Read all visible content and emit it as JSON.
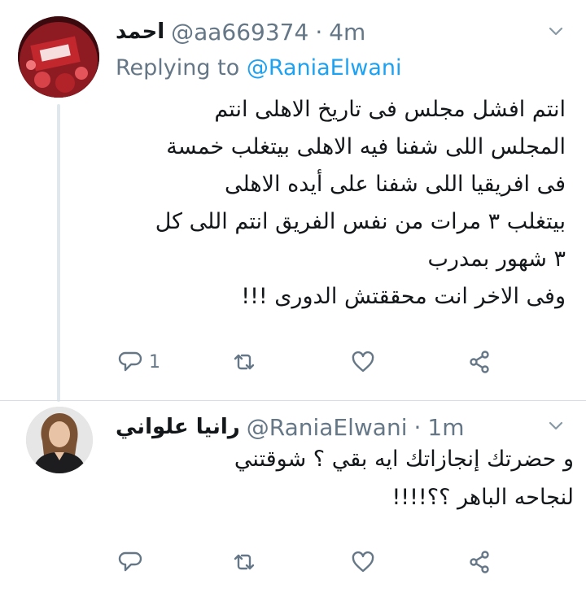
{
  "tweets": [
    {
      "display_name": "احمد",
      "handle": "@aa669374",
      "separator": "·",
      "time": "4m",
      "replying_prefix": "Replying to",
      "replying_handle": "@RaniaElwani",
      "body_lines": [
        "انتم افشل مجلس فى تاريخ الاهلى انتم",
        "المجلس اللى شفنا فيه الاهلى بيتغلب خمسة",
        "فى افريقيا اللى شفنا على أيده الاهلى",
        "بيتغلب ٣ مرات من نفس الفريق انتم اللى كل",
        "٣ شهور بمدرب",
        "وفى الاخر  انت محققتش الدورى !!!"
      ],
      "reply_count": "1",
      "avatar_icon": "avatar-red-flag-icon"
    },
    {
      "display_name": "رانيا علواني",
      "handle": "@RaniaElwani",
      "separator": "·",
      "time": "1m",
      "body_lines": [
        "و حضرتك إنجازاتك ايه بقي ؟ شوقتني",
        "لنجاحه الباهر ؟؟!!!!"
      ],
      "reply_count": "",
      "avatar_icon": "avatar-woman-icon"
    }
  ],
  "colors": {
    "link": "#1da1f2",
    "muted": "#657786",
    "text": "#14171a",
    "line": "#e1e8ed"
  }
}
